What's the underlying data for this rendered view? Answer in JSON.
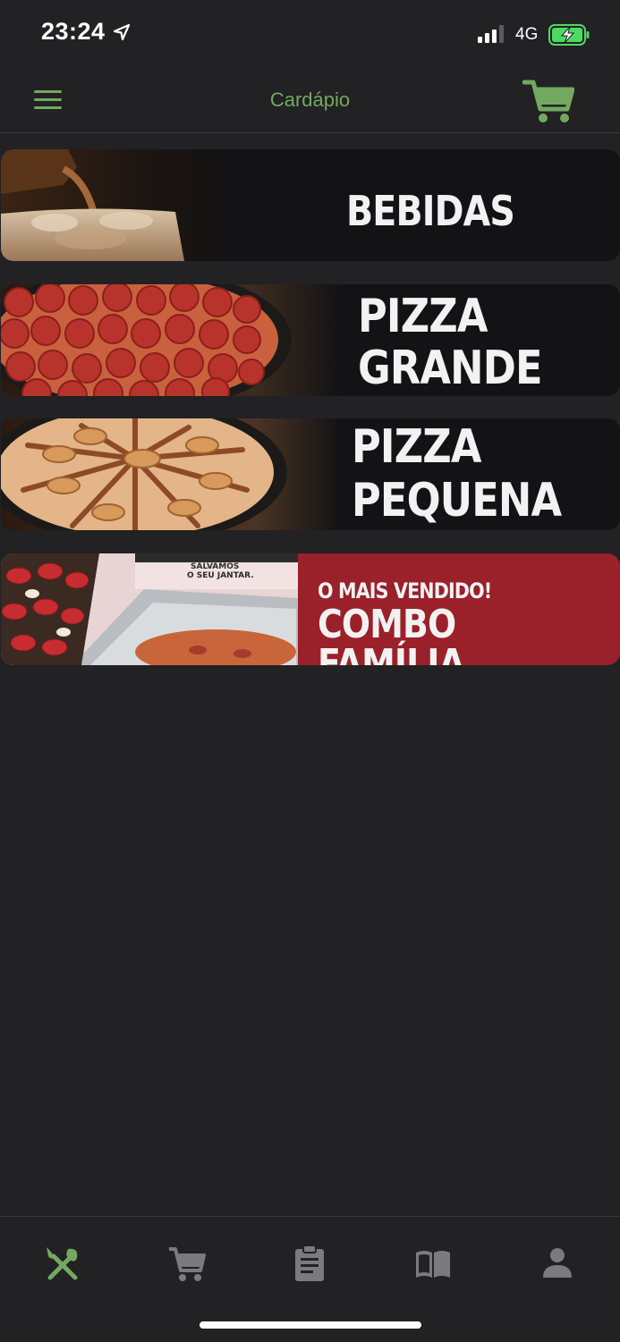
{
  "status_bar": {
    "time": "23:24",
    "network": "4G",
    "icons": [
      "location-arrow-icon",
      "signal-icon",
      "battery-charging-icon"
    ]
  },
  "header": {
    "title": "Cardápio",
    "menu_icon": "hamburger-menu-icon",
    "cart_icon": "cart-icon"
  },
  "colors": {
    "accent": "#73a95f",
    "background": "#222123",
    "banner_red": "#9a2029",
    "nav_inactive": "#7b7a7c"
  },
  "categories": [
    {
      "label": "BEBIDAS"
    },
    {
      "label_line1": "PIZZA",
      "label_line2": "GRANDE"
    },
    {
      "label_line1": "PIZZA",
      "label_line2": "PEQUENA"
    },
    {
      "kicker": "O MAIS VENDIDO!",
      "label": "COMBO FAMÍLIA",
      "box_text_1": "SALVAMOS",
      "box_text_2": "O SEU JANTAR."
    }
  ],
  "bottom_nav": {
    "items": [
      {
        "icon": "utensils-icon",
        "active": true
      },
      {
        "icon": "cart-icon",
        "active": false
      },
      {
        "icon": "orders-clipboard-icon",
        "active": false
      },
      {
        "icon": "menu-book-icon",
        "active": false
      },
      {
        "icon": "profile-icon",
        "active": false
      }
    ]
  }
}
